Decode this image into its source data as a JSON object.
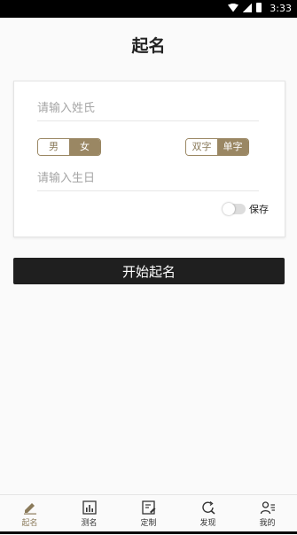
{
  "status": {
    "time": "3:33"
  },
  "title": "起名",
  "form": {
    "surname_placeholder": "请输入姓氏",
    "gender": {
      "male": "男",
      "female": "女",
      "selected": "女"
    },
    "length": {
      "double": "双字",
      "single": "单字",
      "selected": "单字"
    },
    "birthday_placeholder": "请输入生日",
    "save_label": "保存"
  },
  "start_button": "开始起名",
  "tabs": [
    {
      "label": "起名",
      "icon": "pen-icon",
      "active": true
    },
    {
      "label": "测名",
      "icon": "chart-icon",
      "active": false
    },
    {
      "label": "定制",
      "icon": "edit-doc-icon",
      "active": false
    },
    {
      "label": "发现",
      "icon": "refresh-search-icon",
      "active": false
    },
    {
      "label": "我的",
      "icon": "user-list-icon",
      "active": false
    }
  ],
  "colors": {
    "accent": "#9a8763",
    "button": "#1f1f1f"
  }
}
